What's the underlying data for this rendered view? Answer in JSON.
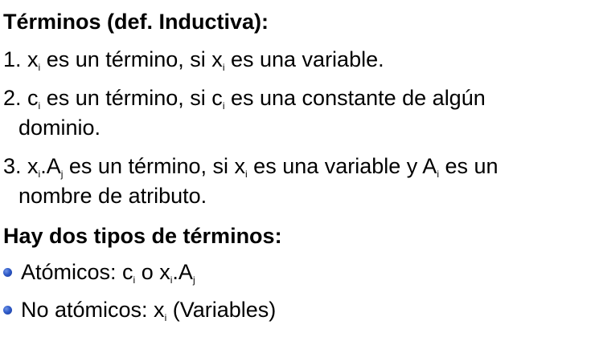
{
  "heading_1": "Términos (def. Inductiva):",
  "items": [
    {
      "num": "1.",
      "l1_t1": "x",
      "l1_s1": "i",
      "l1_t2": " es un término, si x",
      "l1_s2": "i",
      "l1_t3": " es una variable."
    },
    {
      "num": "2.",
      "l1_t1": "c",
      "l1_s1": "i",
      "l1_t2": " es un término, si c",
      "l1_s2": "i",
      "l1_t3": " es una constante de algún",
      "l2": "dominio."
    },
    {
      "num": "3.",
      "l1_t1": "x",
      "l1_s1": "i",
      "l1_t2": ".A",
      "l1_s2": "j",
      "l1_t3": " es un término, si x",
      "l1_s3": "i",
      "l1_t4": " es una variable y A",
      "l1_s4": "i",
      "l1_t5": " es un",
      "l2": "nombre de atributo."
    }
  ],
  "heading_2": "Hay dos tipos de términos:",
  "bullets": [
    {
      "t1": "Atómicos: c",
      "s1": "i",
      "t2": " o x",
      "s2": "i",
      "t3": ".A",
      "s3": "j",
      "t4": ""
    },
    {
      "t1": "No atómicos: x",
      "s1": "i",
      "t2": " (Variables)"
    }
  ],
  "colors": {
    "text": "#000000",
    "bullet": "#2f5bc8",
    "background": "#ffffff"
  }
}
